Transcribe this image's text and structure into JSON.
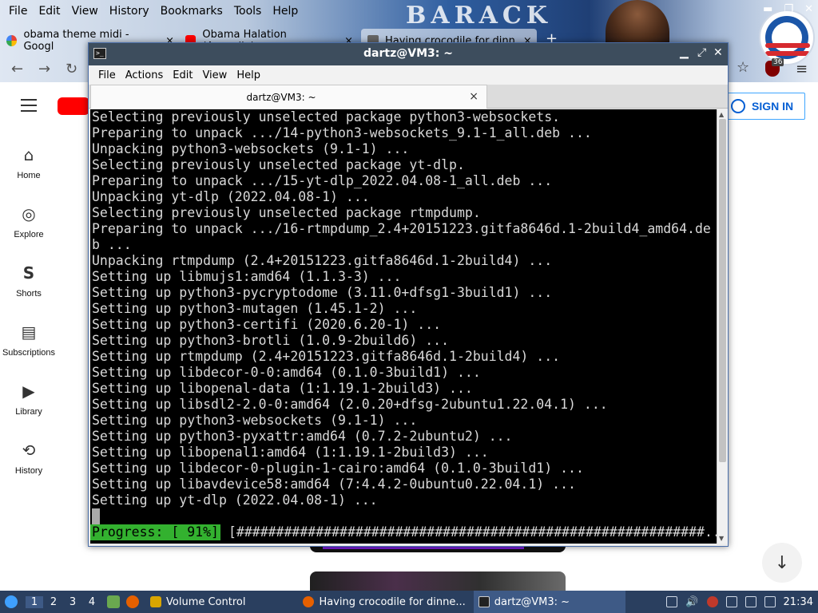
{
  "firefox": {
    "menu": [
      "File",
      "Edit",
      "View",
      "History",
      "Bookmarks",
      "Tools",
      "Help"
    ],
    "persona_text": "BARACK",
    "tabs": [
      {
        "label": "obama theme midi - Googl",
        "close": "×"
      },
      {
        "label": "Obama Halation (Acapella)",
        "close": "×"
      },
      {
        "label": "Having crocodile for dinn",
        "close": "×"
      }
    ],
    "newtab": "+",
    "ublock_count": "36"
  },
  "youtube": {
    "sidebar": [
      {
        "icon": "⌂",
        "label": "Home"
      },
      {
        "icon": "◎",
        "label": "Explore"
      },
      {
        "icon": "S",
        "label": "Shorts"
      },
      {
        "icon": "▤",
        "label": "Subscriptions"
      },
      {
        "icon": "▶",
        "label": "Library"
      },
      {
        "icon": "⟲",
        "label": "History"
      }
    ],
    "sign_in": "SIGN IN",
    "scroll_down_icon": "↓"
  },
  "terminal": {
    "window_title": "dartz@VM3: ~",
    "menu": [
      "File",
      "Actions",
      "Edit",
      "View",
      "Help"
    ],
    "tab_title": "dartz@VM3: ~",
    "tab_close": "×",
    "lines": [
      "Selecting previously unselected package python3-websockets.",
      "Preparing to unpack .../14-python3-websockets_9.1-1_all.deb ...",
      "Unpacking python3-websockets (9.1-1) ...",
      "Selecting previously unselected package yt-dlp.",
      "Preparing to unpack .../15-yt-dlp_2022.04.08-1_all.deb ...",
      "Unpacking yt-dlp (2022.04.08-1) ...",
      "Selecting previously unselected package rtmpdump.",
      "Preparing to unpack .../16-rtmpdump_2.4+20151223.gitfa8646d.1-2build4_amd64.de",
      "b ...",
      "Unpacking rtmpdump (2.4+20151223.gitfa8646d.1-2build4) ...",
      "Setting up libmujs1:amd64 (1.1.3-3) ...",
      "Setting up python3-pycryptodome (3.11.0+dfsg1-3build1) ...",
      "Setting up python3-mutagen (1.45.1-2) ...",
      "Setting up python3-certifi (2020.6.20-1) ...",
      "Setting up python3-brotli (1.0.9-2build6) ...",
      "Setting up rtmpdump (2.4+20151223.gitfa8646d.1-2build4) ...",
      "Setting up libdecor-0-0:amd64 (0.1.0-3build1) ...",
      "Setting up libopenal-data (1:1.19.1-2build3) ...",
      "Setting up libsdl2-2.0-0:amd64 (2.0.20+dfsg-2ubuntu1.22.04.1) ...",
      "Setting up python3-websockets (9.1-1) ...",
      "Setting up python3-pyxattr:amd64 (0.7.2-2ubuntu2) ...",
      "Setting up libopenal1:amd64 (1:1.19.1-2build3) ...",
      "Setting up libdecor-0-plugin-1-cairo:amd64 (0.1.0-3build1) ...",
      "Setting up libavdevice58:amd64 (7:4.4.2-0ubuntu0.22.04.1) ...",
      "Setting up yt-dlp (2022.04.08-1) ..."
    ],
    "progress_label": "Progress: [ 91%]",
    "progress_bar": "[###########################################################.....]",
    "progress_value": 0.91
  },
  "taskbar": {
    "workspaces": [
      "1",
      "2",
      "3",
      "4"
    ],
    "tasks": [
      {
        "label": "Volume Control"
      },
      {
        "label": "Having crocodile for dinne..."
      },
      {
        "label": "dartz@VM3: ~"
      }
    ],
    "clock": "21:34"
  },
  "colors": {
    "terminal_bg": "#000000",
    "progress_green": "#33b12f",
    "youtube_red": "#ff0000",
    "youtube_blue": "#065fd4",
    "taskbar": "#2a3f5f"
  }
}
